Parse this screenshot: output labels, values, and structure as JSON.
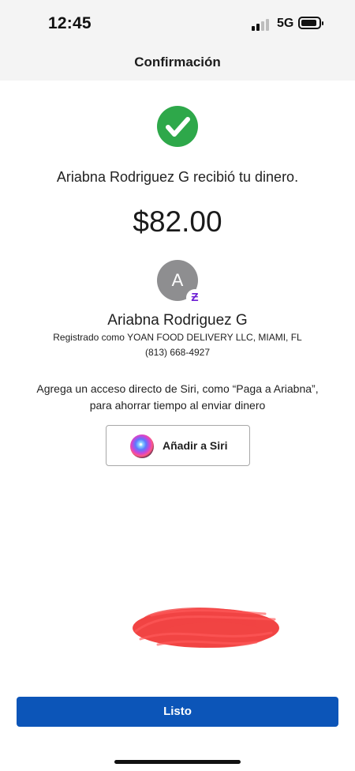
{
  "status_bar": {
    "time": "12:45",
    "network": "5G",
    "signal_bars": 2,
    "signal_max": 4
  },
  "nav": {
    "title": "Confirmación"
  },
  "confirmation": {
    "icon": "check-circle-icon",
    "message": "Ariabna Rodriguez G recibió tu dinero.",
    "amount": "$82.00"
  },
  "recipient": {
    "initial": "A",
    "badge_icon": "zelle-icon",
    "badge_glyph": "Ƶ",
    "name": "Ariabna Rodriguez G",
    "registered_as": "Registrado como YOAN FOOD DELIVERY LLC, MIAMI, FL",
    "phone": "(813) 668-4927"
  },
  "siri_prompt": {
    "line1": "Agrega un acceso directo de Siri, como “Paga a Ariabna”,",
    "line2": "para ahorrar tiempo al enviar dinero",
    "button_label": "Añadir a Siri",
    "button_icon": "siri-icon"
  },
  "footer": {
    "done_label": "Listo"
  },
  "colors": {
    "success": "#2ea84a",
    "primary": "#0c55b8",
    "zelle": "#6d1ed4",
    "redaction": "#f0302f"
  }
}
